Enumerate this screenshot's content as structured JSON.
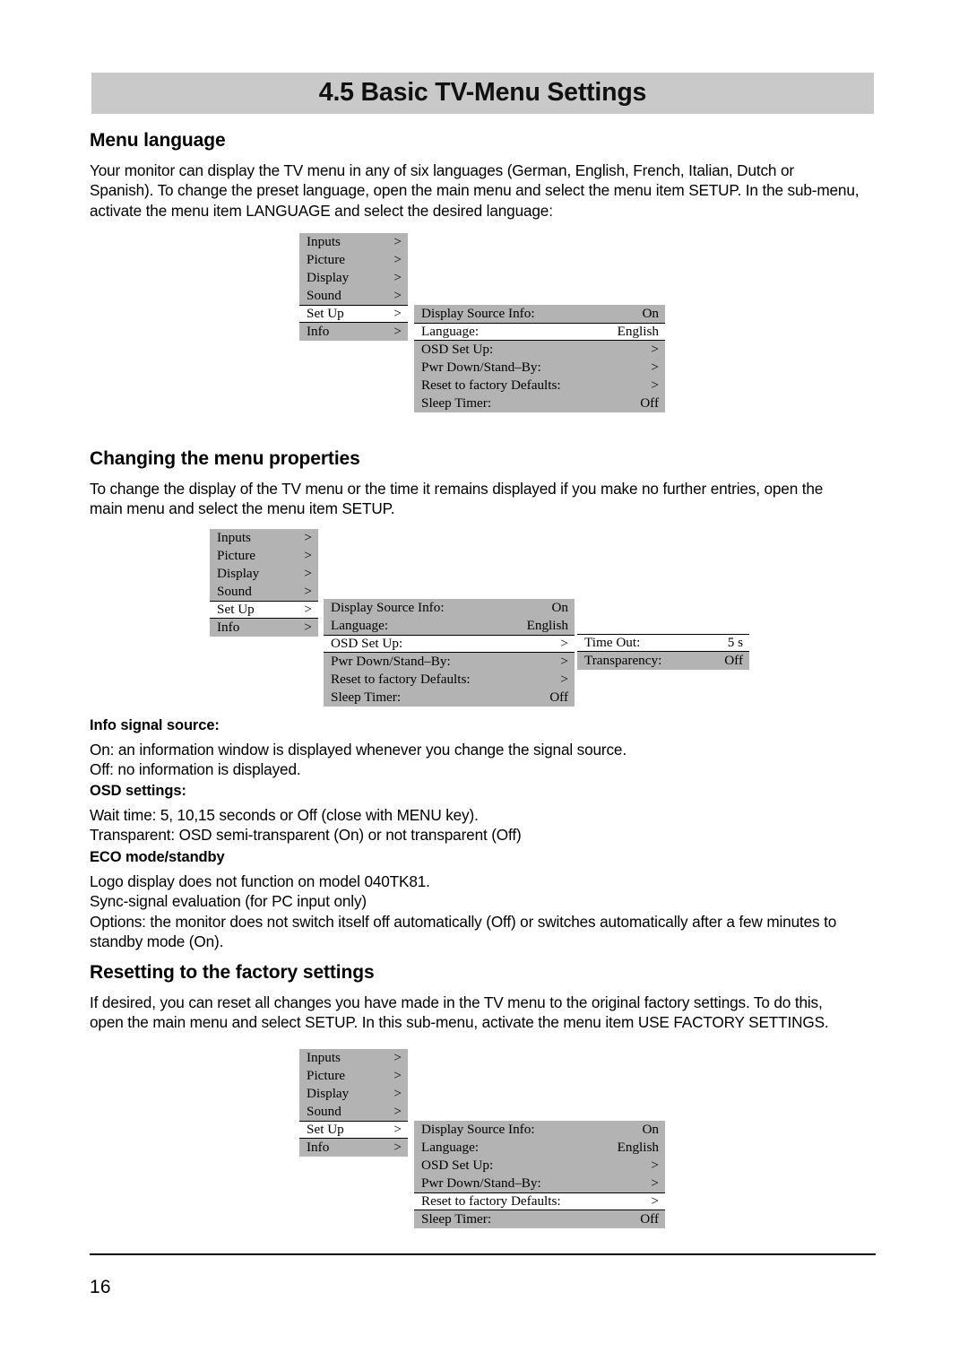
{
  "header": {
    "title": "4.5 Basic TV-Menu Settings"
  },
  "sections": {
    "menu_language": {
      "heading": "Menu language",
      "paragraph_line1": "Your monitor can display the TV menu in any of six languages (German, English, French, Italian, Dutch or",
      "paragraph_line2": "Spanish). To change the preset language, open the main menu and select the menu item SETUP. In the sub-menu,",
      "paragraph_line3": "activate the menu item LANGUAGE and select the desired language:"
    },
    "changing_menu_properties": {
      "heading": "Changing the menu properties",
      "paragraph_line1": "To change the display of the TV menu or the time it remains displayed if you make no further entries, open the",
      "paragraph_line2": "main menu and select the menu item SETUP."
    },
    "info_signal_source": {
      "heading": "Info signal source:",
      "line1": "On: an information window is displayed whenever you change the signal source.",
      "line2": "Off: no information is displayed."
    },
    "osd_settings": {
      "heading": "OSD settings:",
      "line1": "Wait time: 5, 10,15 seconds or Off (close with MENU key).",
      "line2": "Transparent: OSD semi-transparent (On) or not transparent (Off)"
    },
    "eco_mode_standby": {
      "heading": "ECO mode/standby",
      "line1": "Logo display does not function on model 040TK81.",
      "line2": "Sync-signal evaluation (for PC input only)",
      "line3": "Options: the monitor does not switch itself off automatically (Off) or switches automatically after a few minutes to",
      "line4": "standby mode (On)."
    },
    "resetting_factory": {
      "heading": "Resetting to the factory settings",
      "paragraph_line1": "If desired, you can reset all changes you have made in the TV menu to the original factory settings. To do this,",
      "paragraph_line2": "open the main menu and select SETUP. In this sub-menu, activate the menu item USE FACTORY SETTINGS."
    }
  },
  "osd": {
    "main_menu": [
      {
        "label": "Inputs",
        "value": ">",
        "selected": false
      },
      {
        "label": "Picture",
        "value": ">",
        "selected": false
      },
      {
        "label": "Display",
        "value": ">",
        "selected": false
      },
      {
        "label": "Sound",
        "value": ">",
        "selected": false
      },
      {
        "label": "Set Up",
        "value": ">",
        "selected": true
      },
      {
        "label": "Info",
        "value": ">",
        "selected": false
      }
    ],
    "setup_menu_language_selected": [
      {
        "label": "Display Source Info:",
        "value": "On",
        "selected": false
      },
      {
        "label": "Language:",
        "value": "English",
        "selected": true
      },
      {
        "label": "OSD Set Up:",
        "value": ">",
        "selected": false
      },
      {
        "label": "Pwr Down/Stand–By:",
        "value": ">",
        "selected": false
      },
      {
        "label": "Reset to factory Defaults:",
        "value": ">",
        "selected": false
      },
      {
        "label": "Sleep Timer:",
        "value": "Off",
        "selected": false
      }
    ],
    "setup_menu_osd_selected": [
      {
        "label": "Display Source Info:",
        "value": "On",
        "selected": false
      },
      {
        "label": "Language:",
        "value": "English",
        "selected": false
      },
      {
        "label": "OSD Set Up:",
        "value": ">",
        "selected": true
      },
      {
        "label": "Pwr Down/Stand–By:",
        "value": ">",
        "selected": false
      },
      {
        "label": "Reset to factory Defaults:",
        "value": ">",
        "selected": false
      },
      {
        "label": "Sleep Timer:",
        "value": "Off",
        "selected": false
      }
    ],
    "setup_menu_reset_selected": [
      {
        "label": "Display Source Info:",
        "value": "On",
        "selected": false
      },
      {
        "label": "Language:",
        "value": "English",
        "selected": false
      },
      {
        "label": "OSD Set Up:",
        "value": ">",
        "selected": false
      },
      {
        "label": "Pwr Down/Stand–By:",
        "value": ">",
        "selected": false
      },
      {
        "label": "Reset to factory Defaults:",
        "value": ">",
        "selected": true
      },
      {
        "label": "Sleep Timer:",
        "value": "Off",
        "selected": false
      }
    ],
    "osd_setup_submenu": [
      {
        "label": "Time Out:",
        "value": "5 s",
        "selected": true
      },
      {
        "label": "Transparency:",
        "value": "Off",
        "selected": false
      }
    ]
  },
  "footer": {
    "page_number": "16"
  },
  "colors": {
    "header_bar": "#c9c9c9",
    "osd_background": "#b3b3b3",
    "osd_selected": "#ffffff",
    "text": "#000000"
  }
}
